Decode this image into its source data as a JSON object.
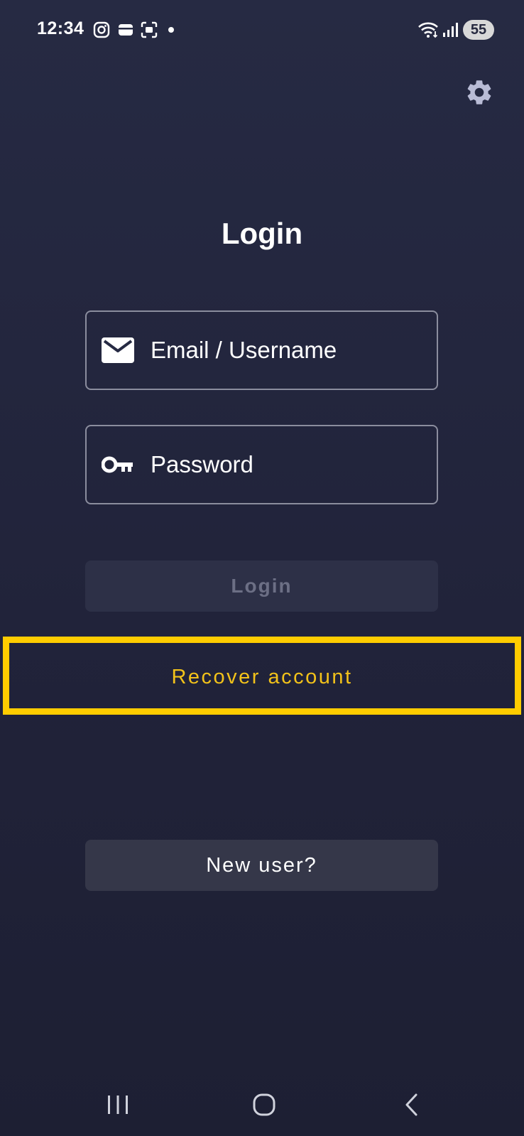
{
  "status_bar": {
    "time": "12:34",
    "icons": [
      "instagram-icon",
      "wallet-icon",
      "screenshot-icon",
      "notification-dot",
      "wifi-icon",
      "signal-icon"
    ],
    "battery": "55"
  },
  "header": {
    "settings_icon": "gear-icon"
  },
  "login_form": {
    "title": "Login",
    "email": {
      "icon": "mail-icon",
      "placeholder": "Email / Username",
      "value": ""
    },
    "password": {
      "icon": "key-icon",
      "placeholder": "Password",
      "value": ""
    },
    "login_button": "Login",
    "recover_button": "Recover account",
    "new_user_button": "New user?"
  },
  "colors": {
    "background": "#262a43",
    "accent": "#f2c21a",
    "highlight": "#ffcc00",
    "disabled_button": "#2d3047",
    "secondary_button": "#353749"
  },
  "nav_bar": {
    "buttons": [
      "recent-apps-icon",
      "home-icon",
      "back-icon"
    ]
  }
}
